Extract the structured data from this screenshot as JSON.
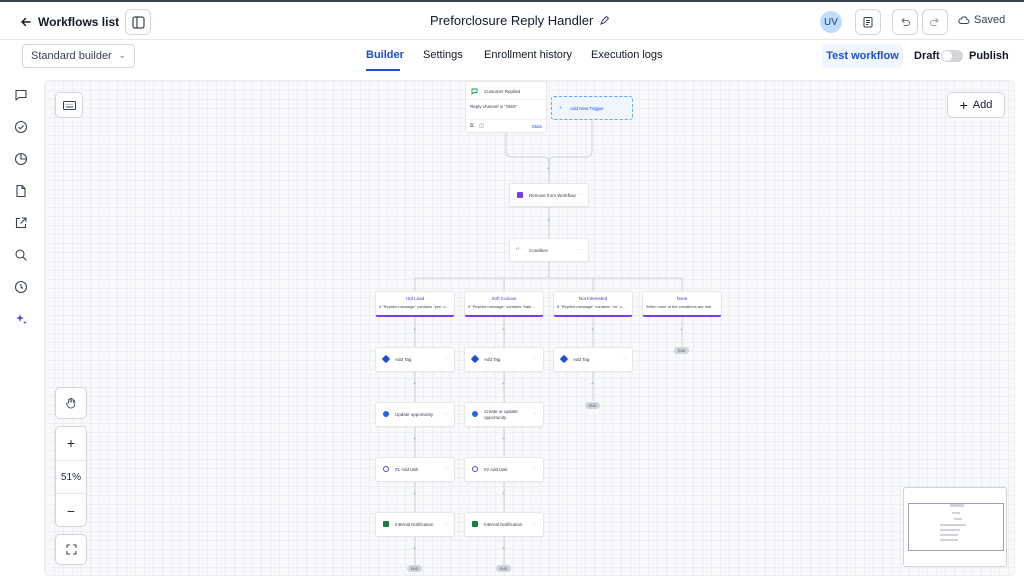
{
  "header": {
    "back_label": "Workflows list",
    "title": "Preforclosure Reply Handler",
    "avatar_initials": "UV",
    "saved_label": "Saved"
  },
  "subheader": {
    "builder_select": "Standard builder",
    "tabs": [
      {
        "label": "Builder",
        "active": true
      },
      {
        "label": "Settings",
        "active": false
      },
      {
        "label": "Enrollment history",
        "active": false
      },
      {
        "label": "Execution logs",
        "active": false
      }
    ],
    "test_button": "Test workflow",
    "draft_label": "Draft",
    "publish_label": "Publish",
    "publish_on": false
  },
  "sidebar": {
    "icons": [
      "chat-icon",
      "check-circle-icon",
      "pie-chart-icon",
      "document-icon",
      "external-link-icon",
      "search-icon",
      "history-icon",
      "sparkle-icon"
    ]
  },
  "canvas": {
    "add_label": "Add",
    "zoom": "51%",
    "trigger": {
      "name": "Customer Replied",
      "filter": "Reply channel is \"SMS\"",
      "stats": "Stats"
    },
    "add_trigger": "Add New Trigger",
    "remove_node": "Remove from Workflow",
    "condition_node": "Condition",
    "branches": [
      {
        "title": "Hot Lead",
        "desc": "If \"Replied message\" contains \"yes\" o..."
      },
      {
        "title": "Soft Curious",
        "desc": "If \"Replied message\" contains \"hate..."
      },
      {
        "title": "Not Interested",
        "desc": "If \"Replied message\" contains \"no\" o..."
      },
      {
        "title": "None",
        "desc": "When none of the conditions are met"
      }
    ],
    "col1": [
      "Add Tag",
      "Update opportunity",
      "#1 Add task",
      "Internal Notification"
    ],
    "col2": [
      "Add Tag",
      "Create or update opportunity",
      "#2 Add task",
      "Internal Notification"
    ],
    "col3": [
      "Add Tag"
    ],
    "end_label": "END"
  },
  "colors": {
    "accent": "#1d4ed8",
    "branch_underline": "#7c3aed",
    "tag_icon": "#1d4ed8",
    "opportunity_icon": "#2563eb",
    "task_icon": "#4f46e5",
    "notify_icon": "#15803d",
    "remove_icon": "#7c3aed"
  }
}
